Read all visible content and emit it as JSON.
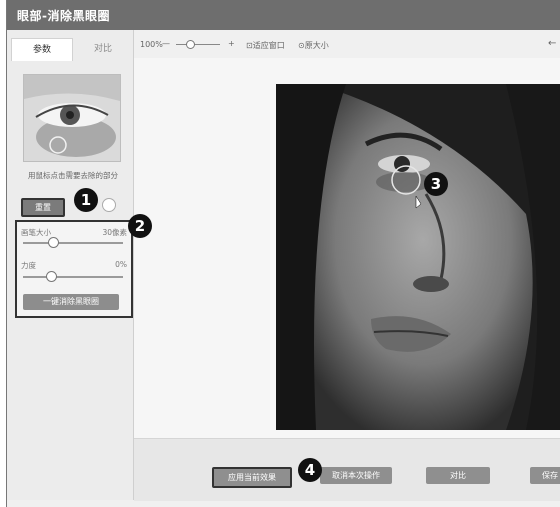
{
  "window": {
    "title": "眼部-消除黑眼圈"
  },
  "tabs": [
    {
      "label": "参数"
    },
    {
      "label": "对比"
    }
  ],
  "left_panel": {
    "hint_text": "用鼠标点击需要去除的部分",
    "small_button": "重置",
    "options": [
      {
        "label": "画笔大小",
        "value": "30像素",
        "level": 0.3
      },
      {
        "label": "力度",
        "value": "0%",
        "level": 0.28
      }
    ],
    "wide_button": "一键消除黑眼圈"
  },
  "toolbar": {
    "zoom": "100%",
    "zoom_minus": "—",
    "zoom_plus": "+",
    "fit_label": "适应窗口",
    "actual_label": "原大小",
    "arrow": "←"
  },
  "bottom_buttons": [
    {
      "label": "应用当前效果"
    },
    {
      "label": "取消本次操作"
    },
    {
      "label": "对比"
    },
    {
      "label": "保存"
    }
  ],
  "callouts": [
    "1",
    "2",
    "3",
    "4"
  ],
  "colors": {
    "titlebar": "#6e6e6e",
    "button": "#8f8f8f",
    "highlight_border": "#333333"
  }
}
